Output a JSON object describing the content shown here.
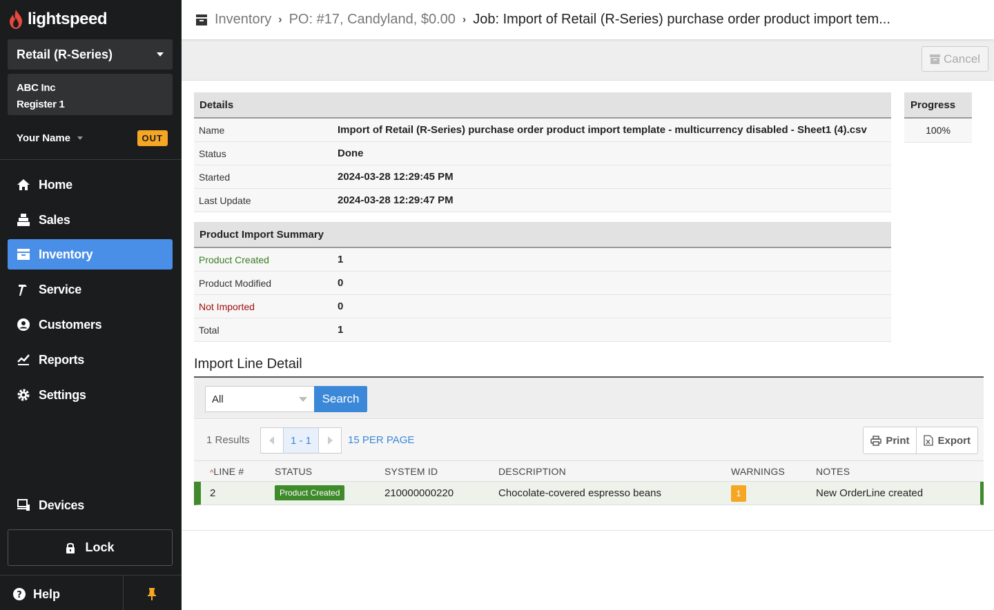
{
  "sidebar": {
    "logo_text": "lightspeed",
    "store": "Retail (R-Series)",
    "company": "ABC Inc",
    "register": "Register 1",
    "user": "Your Name",
    "out_label": "OUT",
    "nav": [
      {
        "label": "Home",
        "icon": "home-icon"
      },
      {
        "label": "Sales",
        "icon": "register-icon"
      },
      {
        "label": "Inventory",
        "icon": "inventory-icon",
        "active": true
      },
      {
        "label": "Service",
        "icon": "hammer-icon"
      },
      {
        "label": "Customers",
        "icon": "user-circle-icon"
      },
      {
        "label": "Reports",
        "icon": "chart-icon"
      },
      {
        "label": "Settings",
        "icon": "gear-icon"
      }
    ],
    "devices": "Devices",
    "lock": "Lock",
    "help": "Help",
    "colors": {
      "bg": "#1b1c1e",
      "active": "#4a8fe7",
      "accent": "#f5a623"
    }
  },
  "breadcrumb": {
    "items": [
      "Inventory",
      "PO: #17, Candyland, $0.00"
    ],
    "current": "Job: Import of Retail (R-Series) purchase order product import tem..."
  },
  "toolbar": {
    "cancel_label": "Cancel"
  },
  "details": {
    "title": "Details",
    "rows": [
      {
        "label": "Name",
        "value": "Import of Retail (R-Series) purchase order product import template - multicurrency disabled - Sheet1 (4).csv"
      },
      {
        "label": "Status",
        "value": "Done"
      },
      {
        "label": "Started",
        "value": "2024-03-28 12:29:45 PM"
      },
      {
        "label": "Last Update",
        "value": "2024-03-28 12:29:47 PM"
      }
    ]
  },
  "progress": {
    "title": "Progress",
    "value": "100%"
  },
  "summary": {
    "title": "Product Import Summary",
    "rows": [
      {
        "label": "Product Created",
        "value": "1"
      },
      {
        "label": "Product Modified",
        "value": "0"
      },
      {
        "label": "Not Imported",
        "value": "0"
      },
      {
        "label": "Total",
        "value": "1"
      }
    ]
  },
  "import_detail": {
    "title": "Import Line Detail",
    "filter_value": "All",
    "search_label": "Search",
    "results_count": "1 Results",
    "page_range": "1 - 1",
    "per_page": "15 PER PAGE",
    "print_label": "Print",
    "export_label": "Export",
    "sort_indicator": "^",
    "columns": [
      "LINE #",
      "STATUS",
      "SYSTEM ID",
      "DESCRIPTION",
      "WARNINGS",
      "NOTES"
    ],
    "rows": [
      {
        "line": "2",
        "status": "Product Created",
        "system_id": "210000000220",
        "description": "Chocolate-covered espresso beans",
        "warnings": "1",
        "notes": "New OrderLine created"
      }
    ]
  }
}
